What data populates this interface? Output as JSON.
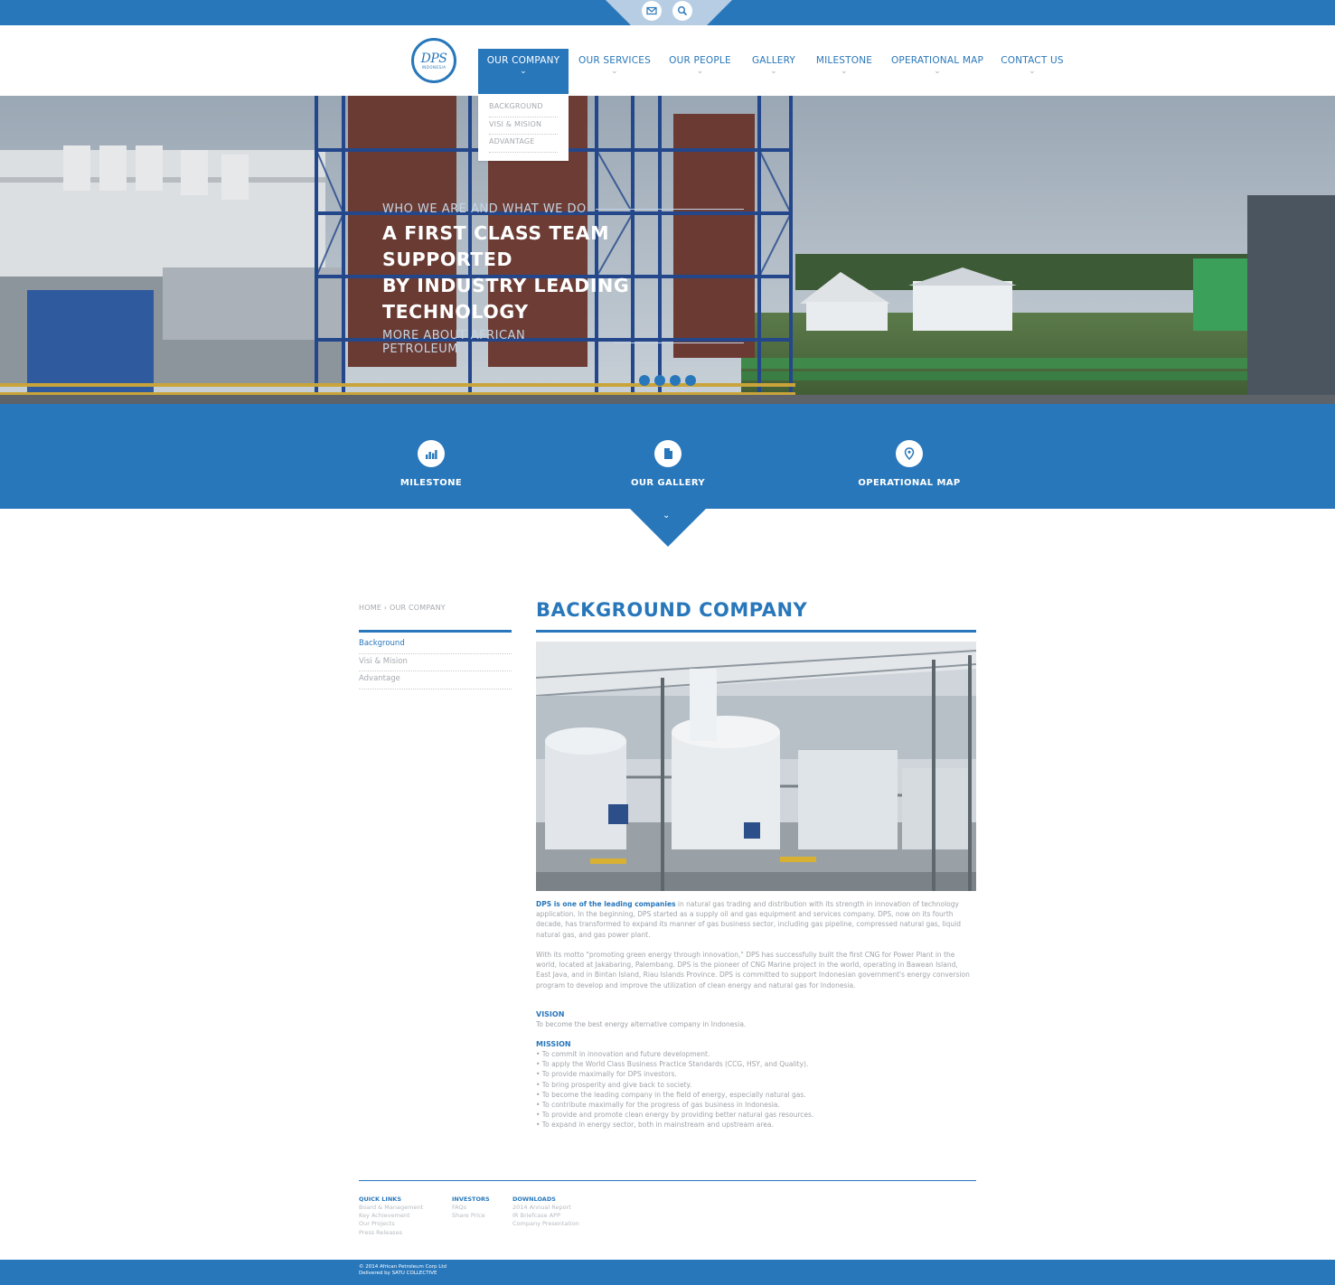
{
  "colors": {
    "brand": "#2877bb",
    "text_muted": "#a0a4a9",
    "white": "#ffffff"
  },
  "topbar": {
    "icons": [
      "envelope-icon",
      "search-icon"
    ]
  },
  "logo": {
    "main": "DPS",
    "sub": "INDONESIA"
  },
  "nav": {
    "items": [
      {
        "label": "OUR COMPANY",
        "active": true
      },
      {
        "label": "OUR SERVICES"
      },
      {
        "label": "OUR PEOPLE"
      },
      {
        "label": "GALLERY"
      },
      {
        "label": "MILESTONE"
      },
      {
        "label": "OPERATIONAL MAP"
      },
      {
        "label": "CONTACT US"
      }
    ],
    "dropdown": [
      "BACKGROUND",
      "VISI & MISION",
      "ADVANTAGE"
    ]
  },
  "hero": {
    "kicker": "WHO WE ARE AND WHAT WE DO",
    "title_line1": "A FIRST CLASS TEAM SUPPORTED",
    "title_line2": "BY INDUSTRY LEADING TECHNOLOGY",
    "more": "MORE ABOUT AFRICAN PETROLEUM",
    "slide_count": 4
  },
  "band": {
    "items": [
      {
        "label": "MILESTONE",
        "icon": "bar-chart-icon"
      },
      {
        "label": "OUR GALLERY",
        "icon": "document-icon"
      },
      {
        "label": "OPERATIONAL MAP",
        "icon": "map-pin-icon"
      }
    ]
  },
  "breadcrumb": "HOME › OUR COMPANY",
  "sidebar": {
    "items": [
      {
        "label": "Background",
        "active": true
      },
      {
        "label": "Visi & Mision"
      },
      {
        "label": "Advantage"
      }
    ]
  },
  "main": {
    "title": "BACKGROUND COMPANY",
    "lead": "DPS is one of the leading companies",
    "para1_rest": " in natural gas trading and distribution with its strength in innovation of technology application. In the beginning, DPS started as a supply oil and gas equipment and services company. DPS, now on its fourth decade, has transformed to expand its manner of gas business sector, including gas pipeline, compressed natural gas, liquid natural gas, and gas power plant.",
    "para2": "With its motto \"promoting green energy through innovation,\" DPS has successfully built the first CNG for Power Plant in the world, located at Jakabaring, Palembang. DPS is the pioneer of CNG Marine project in the world, operating in Bawean Island, East Java, and in Bintan Island, Riau Islands Province. DPS is committed to support Indonesian government's energy conversion program to develop and improve the utilization of clean energy and natural gas for Indonesia.",
    "vision_heading": "VISION",
    "vision_text": "To become the best energy alternative company in Indonesia.",
    "mission_heading": "MISSION",
    "mission": [
      "• To commit in innovation and future development.",
      "• To apply the World Class Business Practice Standards (CCG, HSY, and Quality).",
      "• To provide maximally for DPS investors.",
      "• To bring prosperity and give back to society.",
      "• To become the leading company in the field of energy, especially natural gas.",
      "• To contribute maximally for the progress of gas business in Indonesia.",
      "• To provide and promote clean energy by providing better natural gas resources.",
      "• To expand in energy sector, both in mainstream and upstream area."
    ]
  },
  "footer": {
    "quick_links": {
      "heading": "QUICK LINKS",
      "links": [
        "Board & Management",
        "Key Achievement",
        "Our Projects",
        "Press Releases"
      ]
    },
    "investors": {
      "heading": "INVESTORS",
      "links": [
        "FAQs",
        "Share Price"
      ]
    },
    "downloads": {
      "heading": "DOWNLOADS",
      "links": [
        "2014 Annual Report",
        "IR Briefcase APP",
        "Company Presentation"
      ]
    },
    "copyright": "© 2014 African Petroleum Corp Ltd",
    "delivered": "Delivered by SATU COLLECTIVE"
  }
}
